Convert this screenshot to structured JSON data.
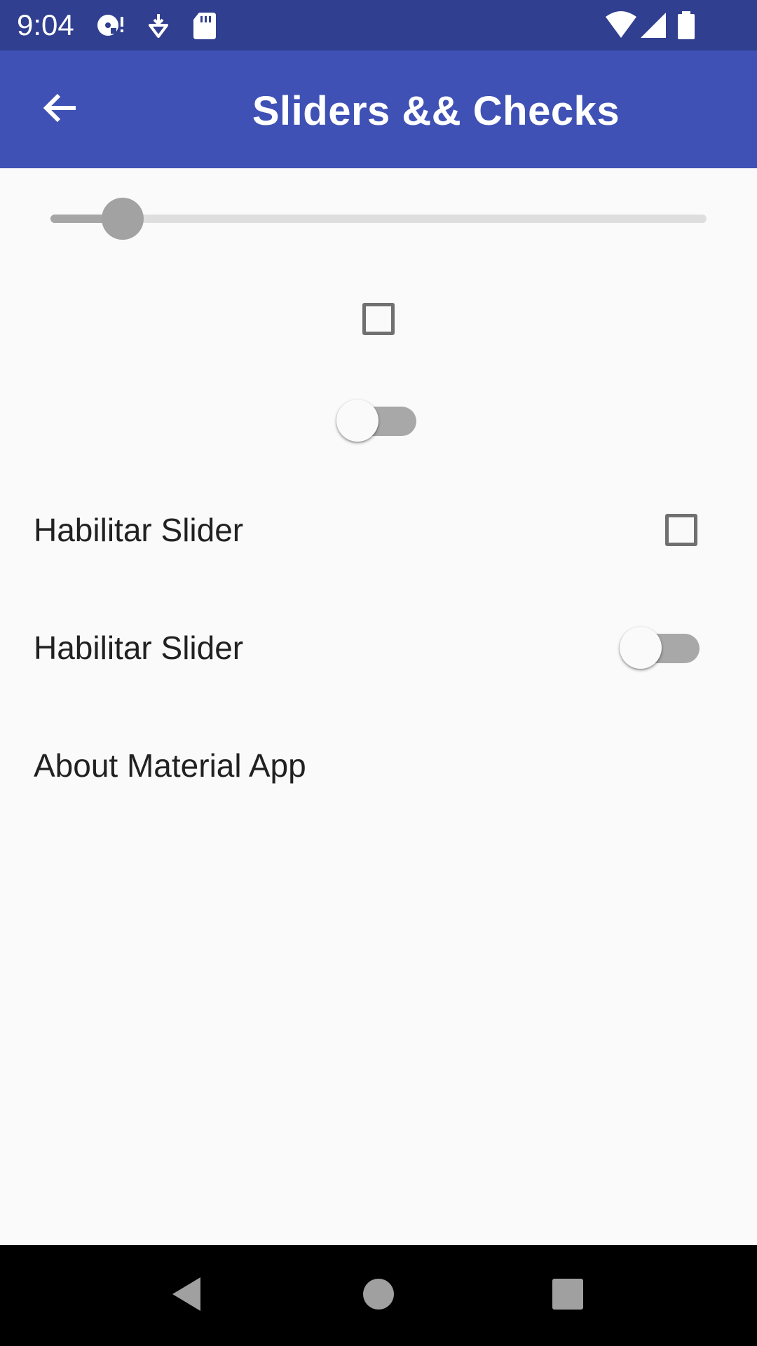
{
  "status_bar": {
    "time": "9:04",
    "left_icons": [
      "disc-alert-icon",
      "download-shield-icon",
      "sd-card-icon"
    ],
    "right_icons": [
      "wifi-icon",
      "cellular-signal-icon",
      "battery-icon"
    ],
    "background": "#303f8f"
  },
  "app_bar": {
    "title": "Sliders && Checks",
    "back_icon": "arrow-back-icon",
    "background": "#3f51b5"
  },
  "controls": {
    "slider": {
      "value": 0.11,
      "enabled": false
    },
    "checkbox": {
      "checked": false
    },
    "switch": {
      "on": false
    }
  },
  "list": {
    "checkbox_row": {
      "label": "Habilitar Slider",
      "checked": false
    },
    "switch_row": {
      "label": "Habilitar Slider",
      "on": false
    },
    "about_row": {
      "label": "About Material App"
    }
  },
  "nav_bar": {
    "buttons": [
      "back-triangle-icon",
      "home-circle-icon",
      "recents-square-icon"
    ]
  }
}
